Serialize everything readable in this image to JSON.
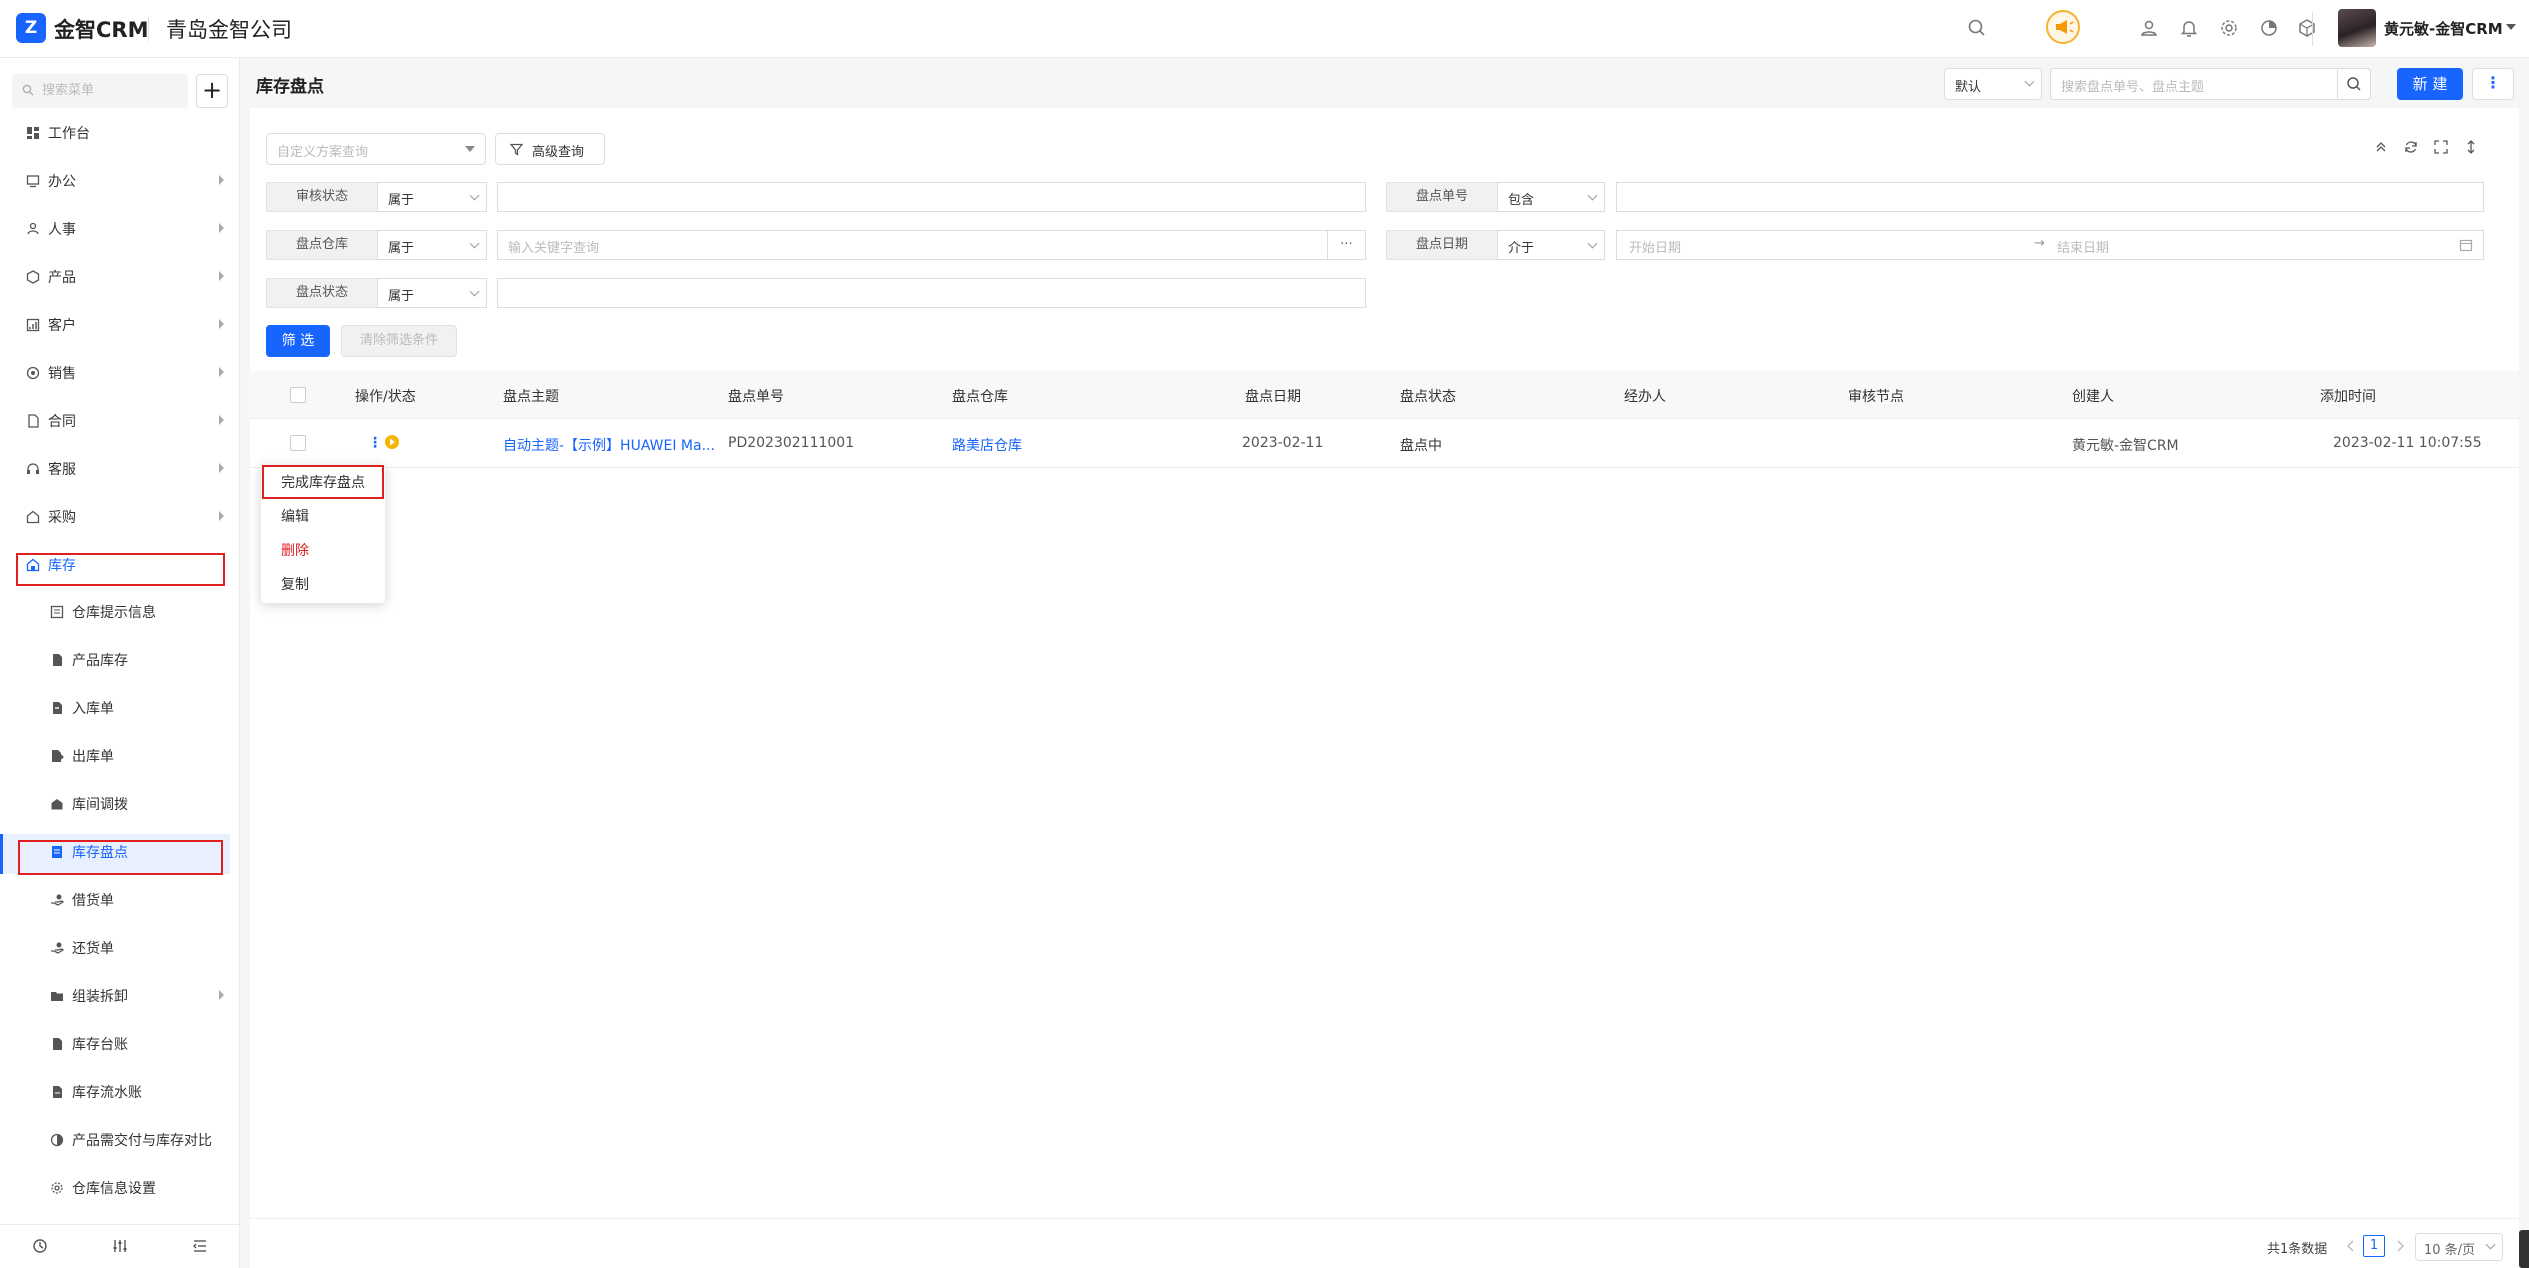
{
  "app": {
    "brand": "金智CRM",
    "logo_glyph": "Z",
    "company": "青岛金智公司"
  },
  "user": {
    "name": "黄元敏-金智CRM"
  },
  "colors": {
    "accent": "#1764ff",
    "danger": "#e02020",
    "warn": "#f59b00"
  },
  "topbar_icons": [
    "search-icon",
    "horn-icon",
    "contacts-icon",
    "bell-icon",
    "gear-icon",
    "pie-chart-icon",
    "cube-icon",
    "chevron-down-icon"
  ],
  "sidebar": {
    "search_placeholder": "搜索菜单",
    "add_label": "+",
    "items": [
      {
        "label": "工作台"
      },
      {
        "label": "办公"
      },
      {
        "label": "人事"
      },
      {
        "label": "产品"
      },
      {
        "label": "客户"
      },
      {
        "label": "销售"
      },
      {
        "label": "合同"
      },
      {
        "label": "客服"
      },
      {
        "label": "采购"
      },
      {
        "label": "库存"
      }
    ],
    "subitems": [
      {
        "label": "仓库提示信息"
      },
      {
        "label": "产品库存"
      },
      {
        "label": "入库单"
      },
      {
        "label": "出库单"
      },
      {
        "label": "库间调拨"
      },
      {
        "label": "库存盘点"
      },
      {
        "label": "借货单"
      },
      {
        "label": "还货单"
      },
      {
        "label": "组装拆卸"
      },
      {
        "label": "库存台账"
      },
      {
        "label": "库存流水账"
      },
      {
        "label": "产品需交付与库存对比"
      },
      {
        "label": "仓库信息设置"
      }
    ]
  },
  "header": {
    "title": "库存盘点",
    "view_select": "默认",
    "search_placeholder": "搜索盘点单号、盘点主题",
    "new_label": "新 建",
    "more_label": "⋮"
  },
  "filters": {
    "scheme_placeholder": "自定义方案查询",
    "advanced_label": "高级查询",
    "rows": [
      {
        "label": "审核状态",
        "op": "属于",
        "value": ""
      },
      {
        "label": "盘点单号",
        "op": "包含",
        "value": ""
      },
      {
        "label": "盘点仓库",
        "op": "属于",
        "placeholder": "输入关键字查询",
        "more": "···"
      },
      {
        "label": "盘点日期",
        "op": "介于",
        "start_placeholder": "开始日期",
        "end_placeholder": "结束日期",
        "arrow": "→"
      },
      {
        "label": "盘点状态",
        "op": "属于",
        "value": ""
      }
    ],
    "filter_btn": "筛 选",
    "clear_btn": "清除筛选条件"
  },
  "table": {
    "columns": [
      "操作/状态",
      "盘点主题",
      "盘点单号",
      "盘点仓库",
      "盘点日期",
      "盘点状态",
      "经办人",
      "审核节点",
      "创建人",
      "添加时间"
    ],
    "rows": [
      {
        "op_dots": "⋮",
        "subject": "自动主题-【示例】HUAWEI Ma...",
        "number": "PD202302111001",
        "warehouse": "路美店仓库",
        "date": "2023-02-11",
        "status": "盘点中",
        "handler": "",
        "audit_node": "",
        "creator": "黄元敏-金智CRM",
        "added": "2023-02-11 10:07:55"
      }
    ]
  },
  "context_menu": [
    "完成库存盘点",
    "编辑",
    "删除",
    "复制"
  ],
  "pagination": {
    "total": "共1条数据",
    "current": "1",
    "page_size": "10 条/页"
  }
}
